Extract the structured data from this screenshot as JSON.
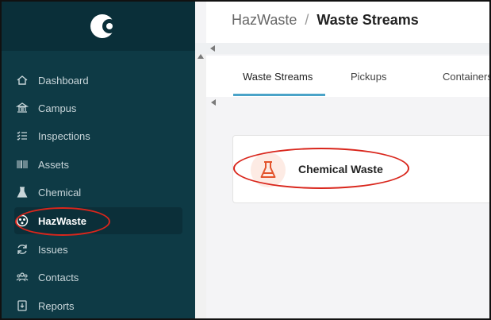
{
  "breadcrumb": {
    "root": "HazWaste",
    "separator": "/",
    "current": "Waste Streams"
  },
  "sidebar": {
    "items": [
      {
        "label": "Dashboard",
        "icon": "home-icon"
      },
      {
        "label": "Campus",
        "icon": "bank-icon"
      },
      {
        "label": "Inspections",
        "icon": "checklist-icon"
      },
      {
        "label": "Assets",
        "icon": "barcode-icon"
      },
      {
        "label": "Chemical",
        "icon": "flask-icon"
      },
      {
        "label": "HazWaste",
        "icon": "biohazard-icon",
        "active": true
      },
      {
        "label": "Issues",
        "icon": "refresh-icon"
      },
      {
        "label": "Contacts",
        "icon": "people-icon"
      },
      {
        "label": "Reports",
        "icon": "report-icon"
      }
    ]
  },
  "tabs": [
    {
      "label": "Waste Streams",
      "active": true
    },
    {
      "label": "Pickups"
    },
    {
      "label": "Containers"
    }
  ],
  "cards": [
    {
      "title": "Chemical Waste",
      "icon": "flask-icon"
    }
  ],
  "colors": {
    "sidebar_bg": "#0e3a45",
    "sidebar_active_bg": "#0b2f39",
    "tab_underline": "#4aa3c8",
    "flask_accent": "#e3542c",
    "annotation_red": "#d9261c"
  }
}
